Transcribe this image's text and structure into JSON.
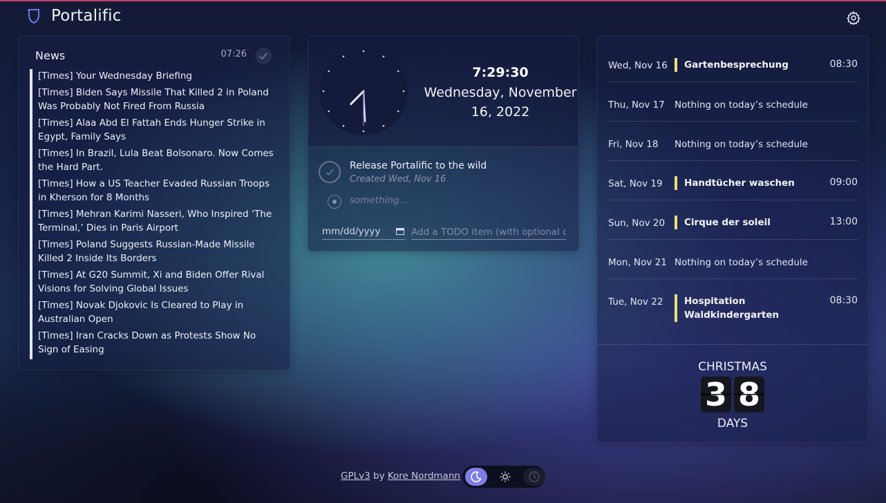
{
  "app": {
    "title": "Portalific"
  },
  "colors": {
    "accent_line": "#c2426a",
    "event_marker": "#e9e07a",
    "theme_active": "#7c7ee6"
  },
  "icons": {
    "logo": "shield-logo-icon",
    "settings": "gear-icon"
  },
  "news": {
    "title": "News",
    "time": "07:26",
    "items": [
      "[Times] Your Wednesday Briefing",
      "[Times] Biden Says Missile That Killed 2 in Poland Was Probably Not Fired From Russia",
      "[Times] Alaa Abd El Fattah Ends Hunger Strike in Egypt, Family Says",
      "[Times] In Brazil, Lula Beat Bolsonaro. Now Comes the Hard Part.",
      "[Times] How a US Teacher Evaded Russian Troops in Kherson for 8 Months",
      "[Times] Mehran Karimi Nasseri, Who Inspired ‘The Terminal,’ Dies in Paris Airport",
      "[Times] Poland Suggests Russian-Made Missile Killed 2 Inside Its Borders",
      "[Times] At G20 Summit, Xi and Biden Offer Rival Visions for Solving Global Issues",
      "[Times] Novak Djokovic Is Cleared to Play in Australian Open",
      "[Times] Iran Cracks Down as Protests Show No Sign of Easing"
    ]
  },
  "clock": {
    "time": "7:29:30",
    "date": "Wednesday, November 16, 2022",
    "hour": 7,
    "minute": 29,
    "second": 30
  },
  "todo": {
    "items": [
      {
        "text": "Release Portalific to the wild",
        "created": "Created Wed, Nov 16"
      }
    ],
    "new_placeholder": "something...",
    "date_placeholder": "mm/dd/yyyy",
    "input_placeholder": "Add a TODO item (with optional due date)"
  },
  "calendar": {
    "days": [
      {
        "day": "Wed, Nov 16",
        "event": "Gartenbesprechung",
        "time": "08:30"
      },
      {
        "day": "Thu, Nov 17",
        "empty": "Nothing on today’s schedule"
      },
      {
        "day": "Fri, Nov 18",
        "empty": "Nothing on today’s schedule"
      },
      {
        "day": "Sat, Nov 19",
        "event": "Handtücher waschen",
        "time": "09:00"
      },
      {
        "day": "Sun, Nov 20",
        "event": "Cirque der soleil",
        "time": "13:00"
      },
      {
        "day": "Mon, Nov 21",
        "empty": "Nothing on today’s schedule"
      },
      {
        "day": "Tue, Nov 22",
        "event": "Hospitation Waldkindergarten",
        "time": "08:30"
      }
    ]
  },
  "countdown": {
    "label": "CHRISTMAS",
    "digits": [
      "3",
      "8"
    ],
    "unit": "DAYS"
  },
  "footer": {
    "license": "GPLv3",
    "by": "by",
    "author": "Kore Nordmann"
  },
  "theme": {
    "options": [
      "dark",
      "light",
      "auto"
    ],
    "selected": "dark"
  }
}
